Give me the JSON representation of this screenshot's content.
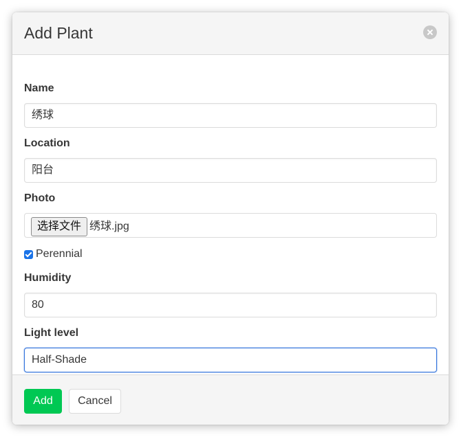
{
  "dialog": {
    "title": "Add Plant",
    "close_icon": "close-icon"
  },
  "form": {
    "name": {
      "label": "Name",
      "value": "绣球"
    },
    "location": {
      "label": "Location",
      "value": "阳台"
    },
    "photo": {
      "label": "Photo",
      "button_label": "选择文件",
      "file_name": "绣球.jpg"
    },
    "perennial": {
      "label": "Perennial",
      "checked": true
    },
    "humidity": {
      "label": "Humidity",
      "value": "80"
    },
    "light_level": {
      "label": "Light level",
      "value": "Half-Shade"
    }
  },
  "footer": {
    "add_label": "Add",
    "cancel_label": "Cancel"
  },
  "colors": {
    "add_button": "#00c853",
    "focus_border": "#3273dc",
    "header_bg": "#f5f5f5"
  }
}
